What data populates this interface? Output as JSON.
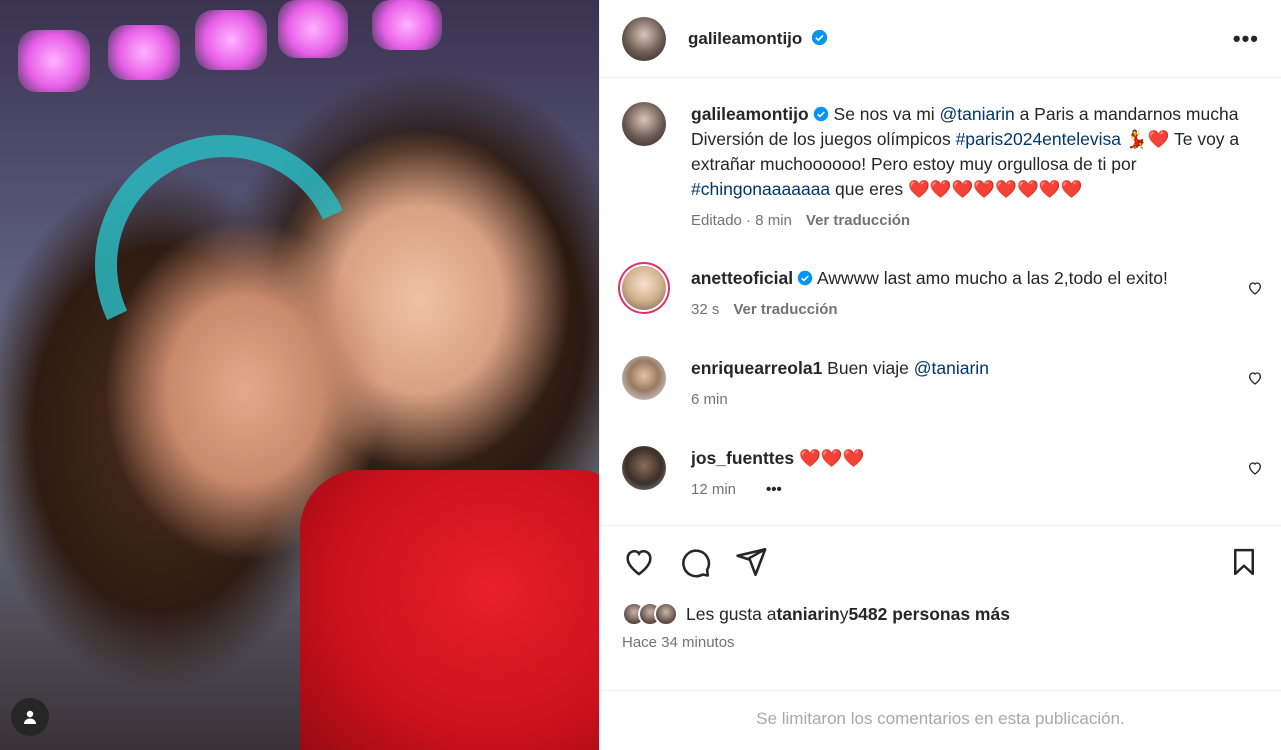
{
  "post": {
    "author": "galileamontijo",
    "more_label": "•••",
    "caption": {
      "username": "galileamontijo",
      "text_1": " Se nos va mi ",
      "mention": "@taniarin",
      "text_2": " a Paris a mandarnos mucha Diversión de los juegos olímpicos ",
      "hashtag_1": "#paris2024entelevisa",
      "text_3": " 💃❤️ Te voy a extrañar muchoooooo! Pero estoy muy orgullosa de ti por ",
      "hashtag_2": "#chingonaaaaaaa",
      "text_4": " que eres ❤️❤️❤️❤️❤️❤️❤️❤️",
      "edited": "Editado · 8 min",
      "translate": "Ver traducción"
    },
    "comments": [
      {
        "username": "anetteoficial",
        "text": " Awwww last amo mucho a las 2,todo el exito!",
        "time": "32 s",
        "translate": "Ver traducción"
      },
      {
        "username": "enriquearreola1",
        "text": " Buen viaje ",
        "mention": "@taniarin",
        "time": "6 min"
      },
      {
        "username": "jos_fuenttes",
        "text": " ❤️❤️❤️",
        "time": "12 min",
        "more": "•••"
      }
    ],
    "likes": {
      "prefix": "Les gusta a ",
      "user": "taniarin",
      "middle": " y ",
      "count": "5482 personas más"
    },
    "time_ago": "Hace 34 minutos",
    "comments_limited": "Se limitaron los comentarios en esta publicación."
  }
}
